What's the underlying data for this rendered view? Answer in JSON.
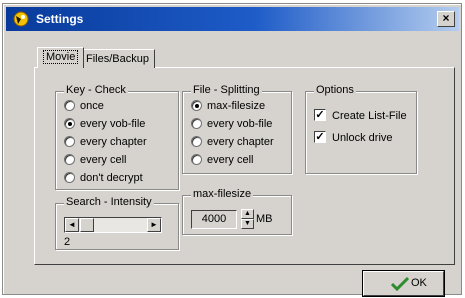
{
  "window": {
    "title": "Settings",
    "close_symbol": "×"
  },
  "tabs": [
    {
      "label": "Movie",
      "selected": true
    },
    {
      "label": "Files/Backup",
      "selected": false
    }
  ],
  "key_check": {
    "legend": "Key - Check",
    "options": [
      "once",
      "every vob-file",
      "every chapter",
      "every cell",
      "don't decrypt"
    ],
    "selected": "every vob-file"
  },
  "file_splitting": {
    "legend": "File - Splitting",
    "options": [
      "max-filesize",
      "every vob-file",
      "every chapter",
      "every cell"
    ],
    "selected": "max-filesize"
  },
  "options": {
    "legend": "Options",
    "create_list_file": {
      "label": "Create List-File",
      "checked": true
    },
    "unlock_drive": {
      "label": "Unlock drive",
      "checked": true
    }
  },
  "search_intensity": {
    "legend": "Search - Intensity",
    "value": "2",
    "left_arrow": "◄",
    "right_arrow": "►"
  },
  "max_filesize": {
    "legend": "max-filesize",
    "value": "4000",
    "unit": "MB",
    "up_arrow": "▲",
    "down_arrow": "▼"
  },
  "ok_button": {
    "label": "OK",
    "icon": "checkmark-icon",
    "icon_color": "#2e8b2e"
  },
  "colors": {
    "titlebar_start": "#083a9a",
    "titlebar_end": "#b5cdee",
    "face": "#d6d3ce"
  }
}
